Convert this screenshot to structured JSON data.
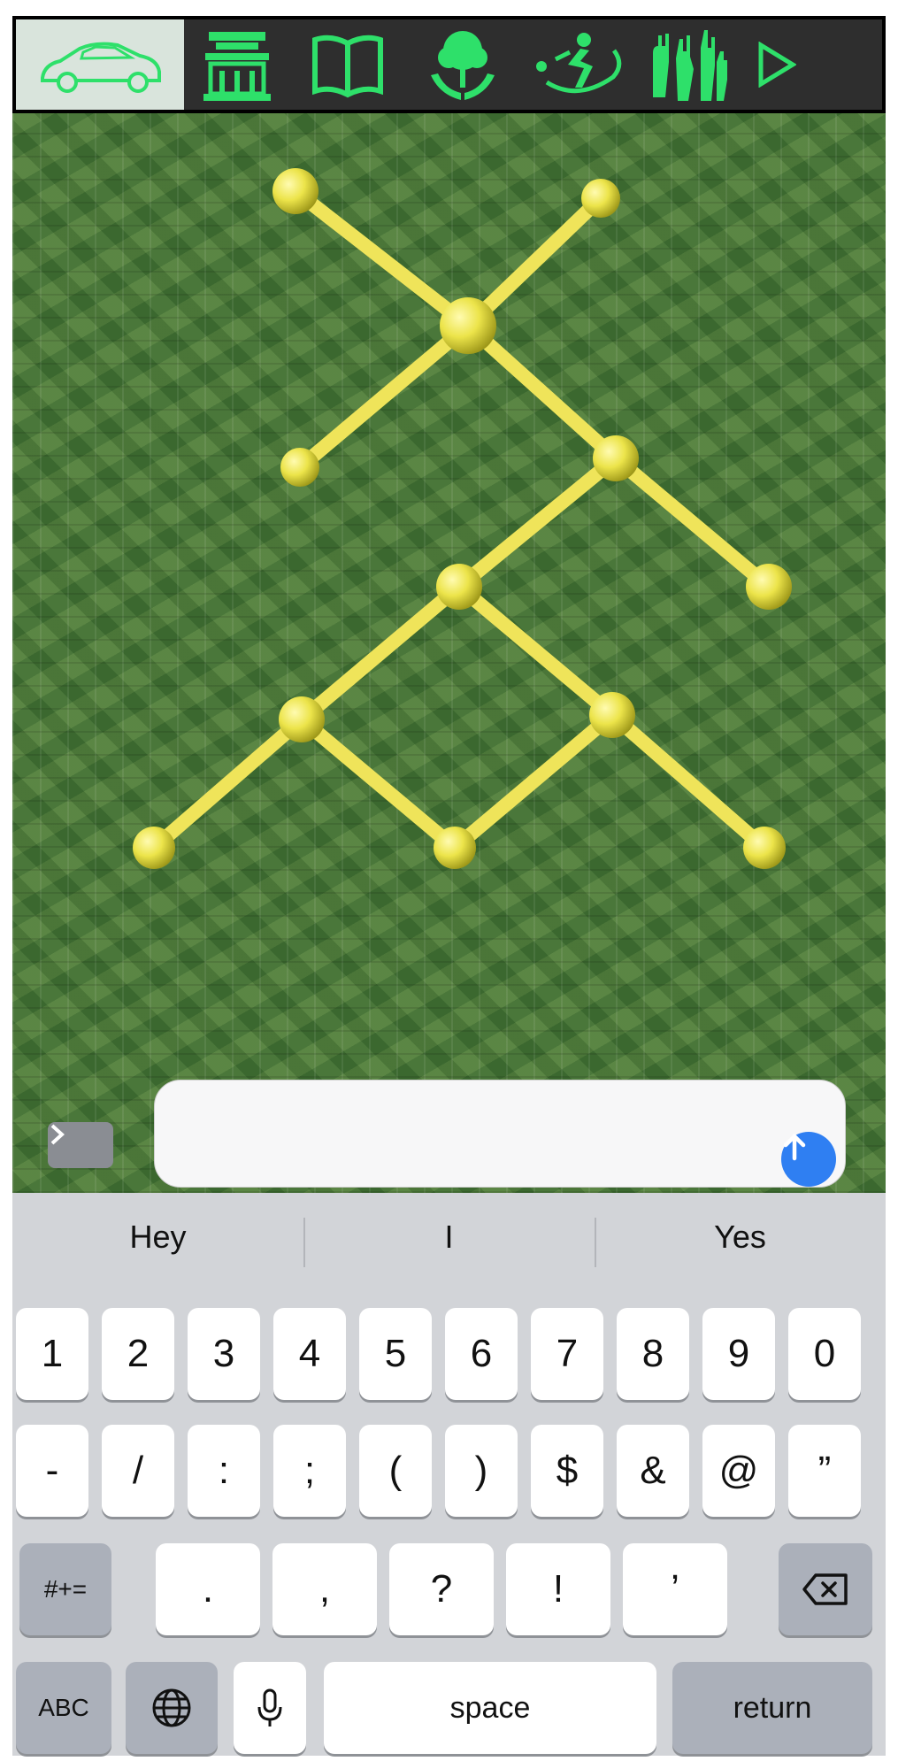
{
  "toolbar": {
    "icons": [
      "car-icon",
      "temple-icon",
      "book-icon",
      "tree-hands-icon",
      "sports-player-icon",
      "raised-hands-icon",
      "play-icon"
    ],
    "accent_color": "#2ee06a",
    "active_index": 0
  },
  "composer": {
    "message_value": "",
    "send_color": "#2f7ff2"
  },
  "keyboard": {
    "suggestions": [
      "Hey",
      "I",
      "Yes"
    ],
    "row1": [
      "1",
      "2",
      "3",
      "4",
      "5",
      "6",
      "7",
      "8",
      "9",
      "0"
    ],
    "row2": [
      "-",
      "/",
      ":",
      ";",
      "(",
      ")",
      "$",
      "&",
      "@",
      "”"
    ],
    "row3_left": "#+=",
    "row3": [
      ".",
      ",",
      "?",
      "!",
      "’"
    ],
    "abc_label": "ABC",
    "space_label": "space",
    "return_label": "return"
  }
}
